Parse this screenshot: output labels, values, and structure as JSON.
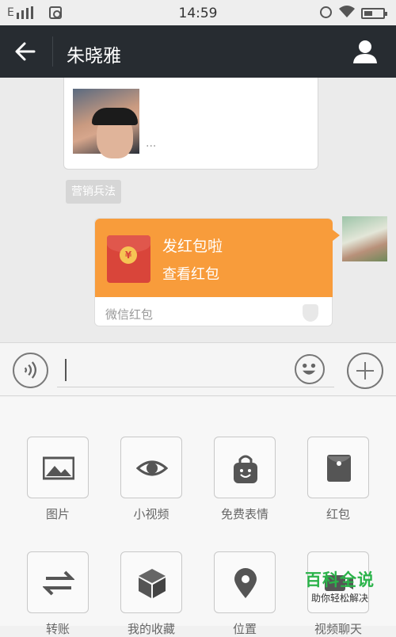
{
  "status_bar": {
    "network": "E",
    "time": "14:59"
  },
  "header": {
    "title": "朱晓雅"
  },
  "chat": {
    "card_more": "...",
    "tag": "营销兵法",
    "red_packet": {
      "title": "发红包啦",
      "subtitle": "查看红包",
      "footer": "微信红包",
      "coin": "¥",
      "color": "#f89c3b"
    }
  },
  "panel": {
    "items": [
      {
        "label": "图片",
        "icon": "image-icon"
      },
      {
        "label": "小视频",
        "icon": "eye-icon"
      },
      {
        "label": "免费表情",
        "icon": "sticker-bag-icon"
      },
      {
        "label": "红包",
        "icon": "red-packet-icon"
      },
      {
        "label": "转账",
        "icon": "transfer-icon"
      },
      {
        "label": "我的收藏",
        "icon": "cube-icon"
      },
      {
        "label": "位置",
        "icon": "location-pin-icon"
      },
      {
        "label": "视频聊天",
        "icon": "video-chat-icon"
      }
    ]
  },
  "watermark": {
    "title": "百科全说",
    "subtitle": "助你轻松解决"
  }
}
